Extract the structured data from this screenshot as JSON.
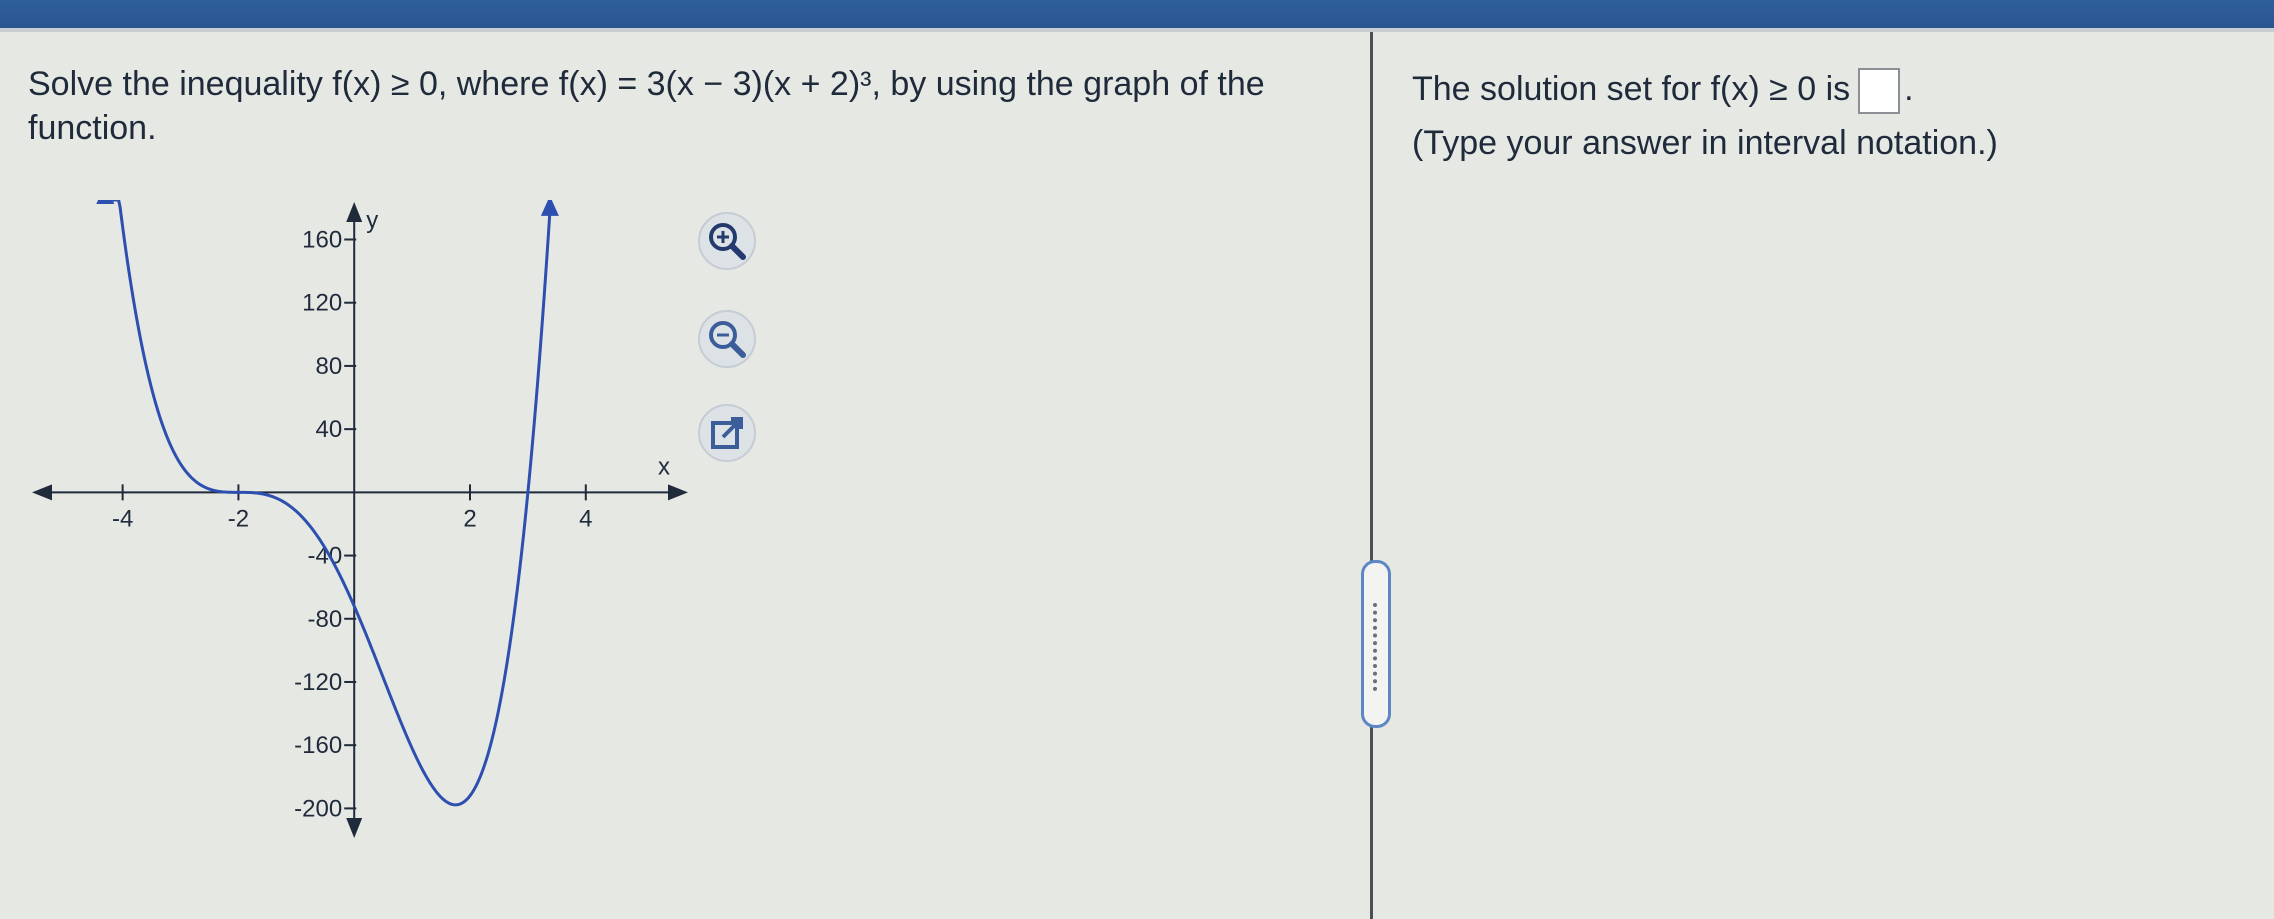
{
  "question": {
    "text": "Solve the inequality f(x) ≥ 0, where f(x) = 3(x − 3)(x + 2)³, by using the graph of the function."
  },
  "answer_panel": {
    "prompt_before": "The solution set for f(x) ≥ 0 is",
    "prompt_after": ".",
    "hint": "(Type your answer in interval notation.)"
  },
  "tools": {
    "zoom_in_icon": "magnifier-plus",
    "zoom_out_icon": "magnifier-minus",
    "popout_icon": "external-window"
  },
  "colors": {
    "curve": "#2d4fb0",
    "axis": "#1f2a3a",
    "topbar": "#2f5f9a"
  },
  "chart_data": {
    "type": "line",
    "function": "f(x) = 3(x - 3)(x + 2)^3",
    "xlabel": "x",
    "ylabel": "y",
    "xlim": [
      -5.6,
      5.8
    ],
    "ylim": [
      -220,
      185
    ],
    "x_ticks": [
      -4,
      -2,
      2,
      4
    ],
    "y_ticks": [
      160,
      120,
      80,
      40,
      -40,
      -80,
      -120,
      -160,
      -200
    ],
    "x_tick_labels": [
      "-4",
      "-2",
      "2",
      "4"
    ],
    "y_tick_labels": [
      "160",
      "120",
      "80",
      "40",
      "-40",
      "-80",
      "-120",
      "-160",
      "-200"
    ],
    "domain_drawn": [
      -4.3,
      3.38
    ]
  }
}
